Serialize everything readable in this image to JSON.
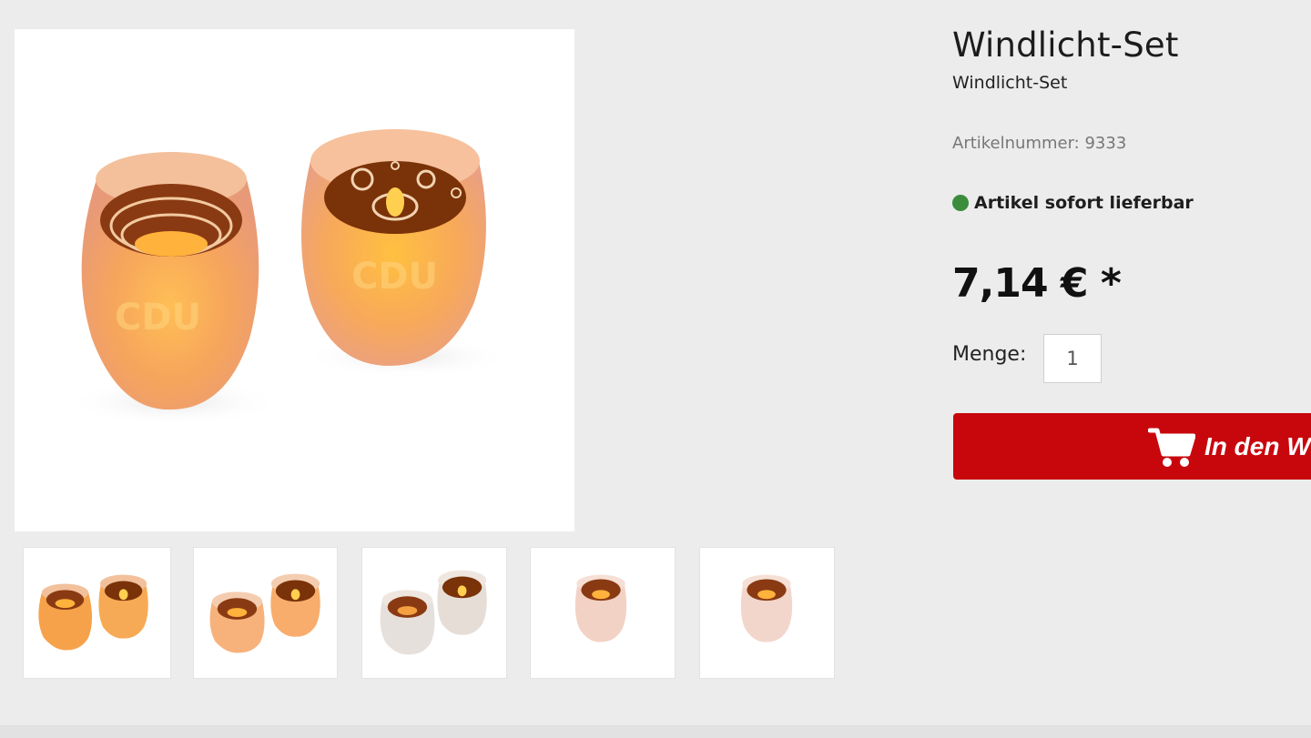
{
  "product": {
    "title": "Windlicht-Set",
    "subtitle": "Windlicht-Set",
    "sku_text": "Artikelnummer: 9333",
    "availability_text": "Artikel sofort lieferbar",
    "availability_color": "#3b8d3b",
    "price_text": "7,14 € *"
  },
  "quantity": {
    "label": "Menge:",
    "value": "1"
  },
  "cart_button": {
    "label": "In den W",
    "icon": "shopping-cart-icon",
    "color": "#c8070d"
  },
  "gallery": {
    "main_image": "two frosted orange tealight glasses",
    "thumbnails": [
      "pair of glasses",
      "pair of glasses",
      "pair of glasses",
      "single glass",
      "single glass"
    ]
  }
}
